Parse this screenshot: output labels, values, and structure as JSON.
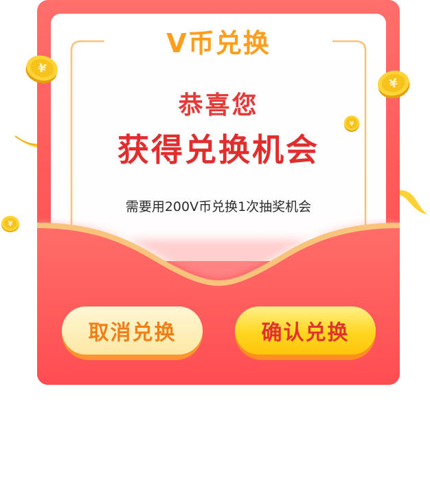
{
  "dialog": {
    "title": "V币兑换",
    "congrats": "恭喜您",
    "headline": "获得兑换机会",
    "description": "需要用200V币兑换1次抽奖机会",
    "cancel_label": "取消兑换",
    "confirm_label": "确认兑换"
  },
  "coin_symbol": "¥",
  "colors": {
    "card_red": "#ff5a5a",
    "title_orange": "#ff9d1c",
    "headline_red": "#e02e2e",
    "wave_edge": "#f8c37a",
    "cancel_bg": "#fde8a4",
    "confirm_bg": "#ffd61f",
    "coin_gold": "#f7c21a"
  },
  "icons": [
    "coin-icon",
    "ribbon-icon"
  ]
}
